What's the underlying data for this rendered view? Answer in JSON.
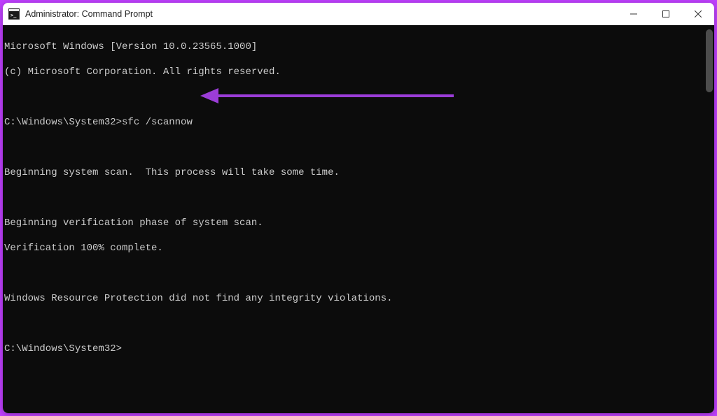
{
  "window": {
    "title": "Administrator: Command Prompt"
  },
  "terminal": {
    "lines": {
      "version": "Microsoft Windows [Version 10.0.23565.1000]",
      "copyright": "(c) Microsoft Corporation. All rights reserved.",
      "blank1": "",
      "prompt1_path": "C:\\Windows\\System32>",
      "prompt1_cmd": "sfc /scannow",
      "blank2": "",
      "scan_begin": "Beginning system scan.  This process will take some time.",
      "blank3": "",
      "verify_begin": "Beginning verification phase of system scan.",
      "verify_done": "Verification 100% complete.",
      "blank4": "",
      "result": "Windows Resource Protection did not find any integrity violations.",
      "blank5": "",
      "prompt2": "C:\\Windows\\System32>"
    }
  },
  "annotation": {
    "color": "#9b3dd8"
  }
}
